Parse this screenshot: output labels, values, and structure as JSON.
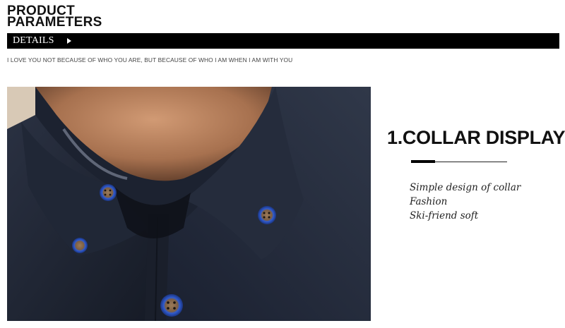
{
  "header": {
    "title_line1": "PRODUCT",
    "title_line2": "PARAMETERS"
  },
  "details_bar": {
    "label": "DETAILS",
    "icon": "play-icon"
  },
  "tagline": "I LOVE YOU NOT BECAUSE OF WHO YOU ARE, BUT BECAUSE OF WHO I AM WHEN I AM WITH YOU",
  "photo": {
    "subject": "collar-photo",
    "colors": {
      "shirt": "#1c2230",
      "skin": "#c08a65",
      "button_ring": "#2850b8"
    }
  },
  "feature": {
    "title": "1.COLLAR DISPLAY",
    "items": [
      "Simple design of collar",
      "Fashion",
      "Ski-friend soft"
    ]
  }
}
